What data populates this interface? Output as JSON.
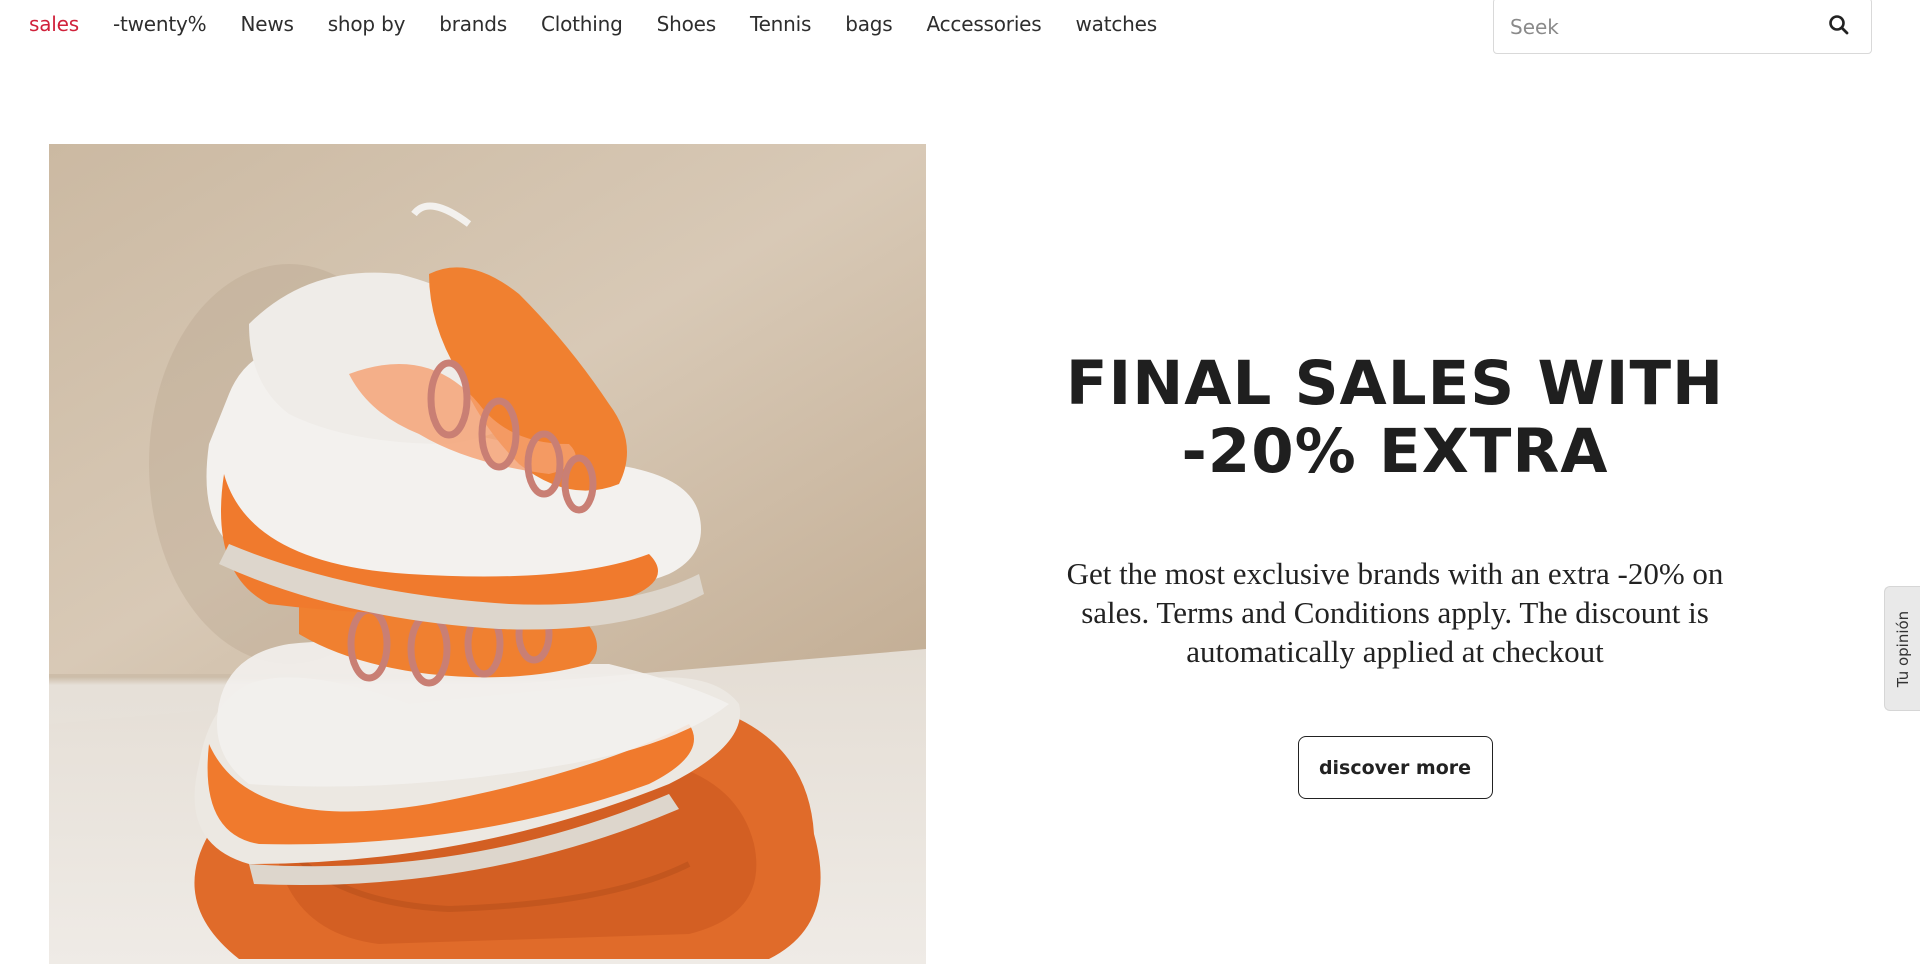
{
  "nav": {
    "items": [
      {
        "label": "sales",
        "active": true
      },
      {
        "label": "-twenty%"
      },
      {
        "label": "News"
      },
      {
        "label": "shop by"
      },
      {
        "label": "brands"
      },
      {
        "label": "Clothing"
      },
      {
        "label": "Shoes"
      },
      {
        "label": "Tennis"
      },
      {
        "label": "bags"
      },
      {
        "label": "Accessories"
      },
      {
        "label": "watches"
      }
    ]
  },
  "search": {
    "placeholder": "Seek",
    "value": ""
  },
  "hero": {
    "image_alt": "Orange and white sneakers stacked on an orange belt",
    "title_line1": "FINAL SALES WITH",
    "title_line2": "-20% EXTRA",
    "description": "Get the most exclusive brands with an extra -20% on sales. Terms and Conditions apply. The discount is automatically applied at checkout",
    "button_label": "discover more"
  },
  "feedback": {
    "label": "Tu opinión"
  },
  "colors": {
    "accent": "#d0213b",
    "shoe_orange": "#f07a2d",
    "text": "#222222"
  }
}
